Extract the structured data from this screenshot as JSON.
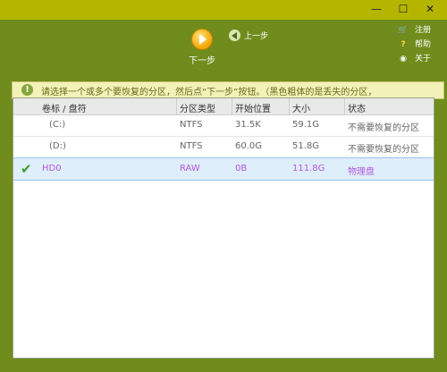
{
  "toolbar": {
    "next_label": "下一步",
    "prev_label": "上一步",
    "register_label": "注册",
    "help_label": "帮助",
    "about_label": "关于"
  },
  "hint": {
    "text": "请选择一个或多个要恢复的分区，然后点“下一步”按钮。（黑色粗体的是丢失的分区，"
  },
  "table": {
    "headers": [
      "卷标 / 盘符",
      "分区类型",
      "开始位置",
      "大小",
      "状态"
    ],
    "rows": [
      {
        "label": "(C:)",
        "type": "NTFS",
        "start": "31.5K",
        "size": "59.1G",
        "status": "不需要恢复的分区"
      },
      {
        "label": "(D:)",
        "type": "NTFS",
        "start": "60.0G",
        "size": "51.8G",
        "status": "不需要恢复的分区"
      },
      {
        "label": "HD0",
        "type": "RAW",
        "start": "0B",
        "size": "111.8G",
        "status": "物理盘"
      }
    ]
  },
  "window_buttons": {
    "minimize": "—",
    "maximize": "☐",
    "close": "✕"
  },
  "colors": {
    "background": "#6f8c1c",
    "titlebar": "#b5b500",
    "hint_bar": "#f2f1b8",
    "selected_text": "#b25ad6"
  }
}
